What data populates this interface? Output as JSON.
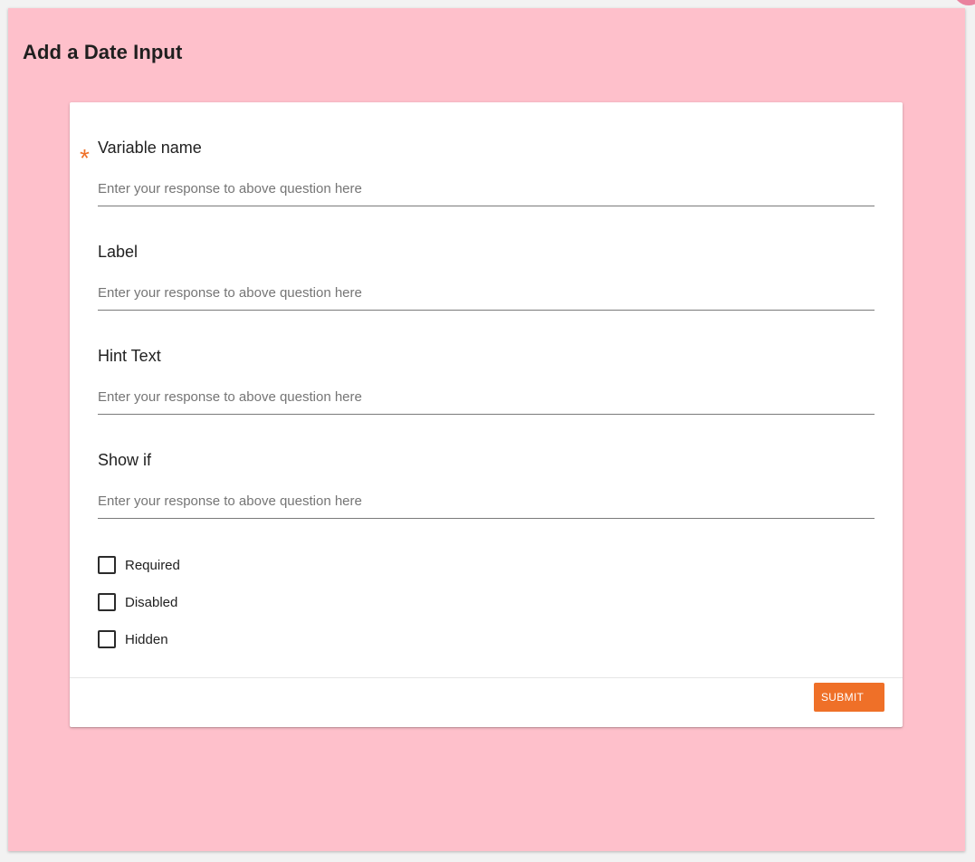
{
  "panel": {
    "title": "Add a Date Input"
  },
  "form": {
    "fields": [
      {
        "label": "Variable name",
        "required_mark": "*",
        "placeholder": "Enter your response to above question here",
        "value": ""
      },
      {
        "label": "Label",
        "placeholder": "Enter your response to above question here",
        "value": ""
      },
      {
        "label": "Hint Text",
        "placeholder": "Enter your response to above question here",
        "value": ""
      },
      {
        "label": "Show if",
        "placeholder": "Enter your response to above question here",
        "value": ""
      }
    ],
    "checkboxes": [
      {
        "label": "Required",
        "checked": false
      },
      {
        "label": "Disabled",
        "checked": false
      },
      {
        "label": "Hidden",
        "checked": false
      }
    ],
    "submit_label": "SUBMIT"
  },
  "colors": {
    "panel_background": "#fec0cb",
    "accent": "#ef7028",
    "card_background": "#ffffff"
  }
}
